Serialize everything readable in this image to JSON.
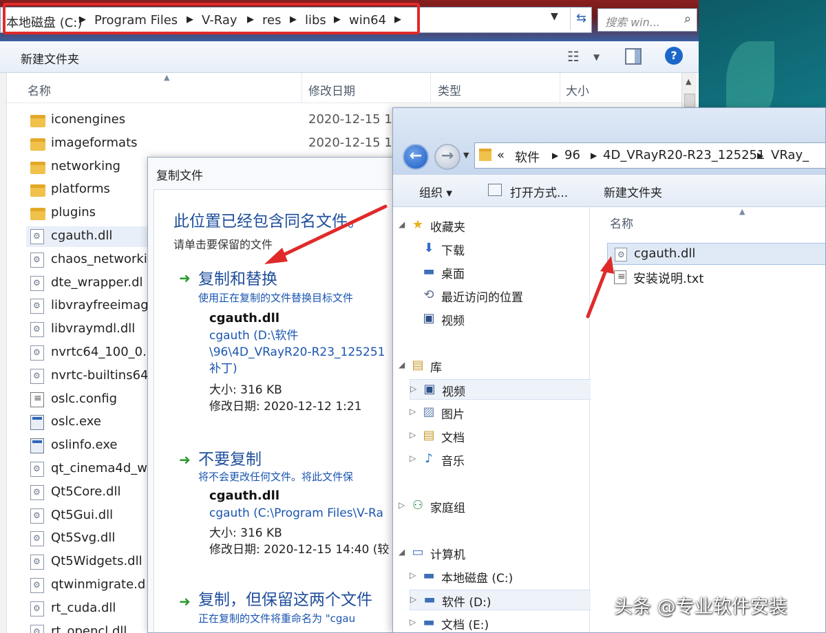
{
  "background_window": {
    "breadcrumb": [
      "本地磁盘 (C:)",
      "Program Files",
      "V-Ray",
      "res",
      "libs",
      "win64"
    ],
    "search_placeholder": "搜索 win...",
    "toolbar": {
      "new_folder": "新建文件夹"
    },
    "columns": {
      "name": "名称",
      "modified": "修改日期",
      "type": "类型",
      "size": "大小"
    },
    "files": [
      {
        "name": "iconengines",
        "date": "2020-12-15 1",
        "kind": "folder"
      },
      {
        "name": "imageformats",
        "date": "2020-12-15 1",
        "kind": "folder"
      },
      {
        "name": "networking",
        "date": "",
        "kind": "folder"
      },
      {
        "name": "platforms",
        "date": "",
        "kind": "folder"
      },
      {
        "name": "plugins",
        "date": "",
        "kind": "folder"
      },
      {
        "name": "cgauth.dll",
        "date": "",
        "kind": "dll"
      },
      {
        "name": "chaos_networki",
        "date": "",
        "kind": "dll"
      },
      {
        "name": "dte_wrapper.dl",
        "date": "",
        "kind": "dll"
      },
      {
        "name": "libvrayfreeimag",
        "date": "",
        "kind": "dll"
      },
      {
        "name": "libvraymdl.dll",
        "date": "",
        "kind": "dll"
      },
      {
        "name": "nvrtc64_100_0.",
        "date": "",
        "kind": "dll"
      },
      {
        "name": "nvrtc-builtins64",
        "date": "",
        "kind": "dll"
      },
      {
        "name": "oslc.config",
        "date": "",
        "kind": "cfg"
      },
      {
        "name": "oslc.exe",
        "date": "",
        "kind": "exe"
      },
      {
        "name": "oslinfo.exe",
        "date": "",
        "kind": "exe"
      },
      {
        "name": "qt_cinema4d_w",
        "date": "",
        "kind": "dll"
      },
      {
        "name": "Qt5Core.dll",
        "date": "",
        "kind": "dll"
      },
      {
        "name": "Qt5Gui.dll",
        "date": "",
        "kind": "dll"
      },
      {
        "name": "Qt5Svg.dll",
        "date": "",
        "kind": "dll"
      },
      {
        "name": "Qt5Widgets.dll",
        "date": "",
        "kind": "dll"
      },
      {
        "name": "qtwinmigrate.d",
        "date": "",
        "kind": "dll"
      },
      {
        "name": "rt_cuda.dll",
        "date": "",
        "kind": "dll"
      },
      {
        "name": "rt_opencl.dll",
        "date": "",
        "kind": "dll"
      }
    ]
  },
  "dialog": {
    "title": "复制文件",
    "heading": "此位置已经包含同名文件。",
    "subheading": "请单击要保留的文件",
    "option1": {
      "title": "复制和替换",
      "desc": "使用正在复制的文件替换目标文件",
      "file": "cgauth.dll",
      "path_lines": [
        "cgauth (D:\\软件",
        "\\96\\4D_VRayR20-R23_125251",
        "补丁)"
      ],
      "size": "大小: 316 KB",
      "modified": "修改日期: 2020-12-12 1:21"
    },
    "option2": {
      "title": "不要复制",
      "desc": "将不会更改任何文件。将此文件保",
      "file": "cgauth.dll",
      "path": "cgauth (C:\\Program Files\\V-Ra",
      "size": "大小: 316 KB",
      "modified": "修改日期: 2020-12-15 14:40 (较"
    },
    "option3": {
      "title": "复制，但保留这两个文件",
      "desc": "正在复制的文件将重命名为 \"cgau"
    }
  },
  "front_window": {
    "breadcrumb": [
      "«",
      "软件",
      "96",
      "4D_VRayR20-R23_125251",
      "VRay_"
    ],
    "toolbar": {
      "organize": "组织 ▾",
      "open_with": "打开方式...",
      "new_folder": "新建文件夹"
    },
    "nav": [
      {
        "label": "收藏夹",
        "icon": "★",
        "indent": 0,
        "twisty": "◢"
      },
      {
        "label": "下载",
        "icon": "⬇",
        "indent": 1,
        "twisty": ""
      },
      {
        "label": "桌面",
        "icon": "▬",
        "indent": 1,
        "twisty": ""
      },
      {
        "label": "最近访问的位置",
        "icon": "⟲",
        "indent": 1,
        "twisty": ""
      },
      {
        "label": "视频",
        "icon": "▣",
        "indent": 1,
        "twisty": ""
      },
      {
        "label": "库",
        "icon": "▤",
        "indent": 0,
        "twisty": "◢"
      },
      {
        "label": "视频",
        "icon": "▣",
        "indent": 1,
        "twisty": "▷",
        "selected": true
      },
      {
        "label": "图片",
        "icon": "▨",
        "indent": 1,
        "twisty": "▷"
      },
      {
        "label": "文档",
        "icon": "▤",
        "indent": 1,
        "twisty": "▷"
      },
      {
        "label": "音乐",
        "icon": "♪",
        "indent": 1,
        "twisty": "▷"
      },
      {
        "label": "家庭组",
        "icon": "⚇",
        "indent": 0,
        "twisty": "▷"
      },
      {
        "label": "计算机",
        "icon": "▭",
        "indent": 0,
        "twisty": "◢"
      },
      {
        "label": "本地磁盘 (C:)",
        "icon": "▬",
        "indent": 1,
        "twisty": "▷"
      },
      {
        "label": "软件 (D:)",
        "icon": "▬",
        "indent": 1,
        "twisty": "▷",
        "selected": true
      },
      {
        "label": "文档 (E:)",
        "icon": "▬",
        "indent": 1,
        "twisty": "▷"
      }
    ],
    "column_name": "名称",
    "files": [
      {
        "name": "cgauth.dll",
        "selected": true,
        "kind": "dll"
      },
      {
        "name": "安装说明.txt",
        "selected": false,
        "kind": "cfg"
      }
    ]
  },
  "watermark": "头条 @专业软件安装",
  "colors": {
    "highlight_red": "#e02a2a",
    "link_blue": "#1f4e9c",
    "arrow_green": "#2a9a2a"
  }
}
